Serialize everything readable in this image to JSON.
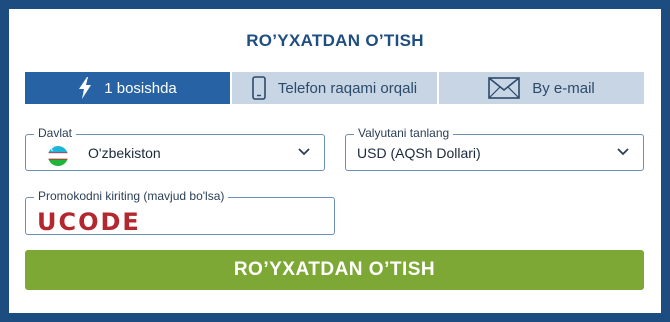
{
  "header": {
    "title": "RO’YXATDAN O’TISH"
  },
  "tabs": [
    {
      "label": "1 bosishda",
      "icon": "lightning-icon",
      "active": true
    },
    {
      "label": "Telefon raqami orqali",
      "icon": "phone-icon",
      "active": false
    },
    {
      "label": "By e-mail",
      "icon": "envelope-icon",
      "active": false
    }
  ],
  "country": {
    "label": "Davlat",
    "value": "O'zbekiston",
    "flag": "uzbekistan-flag-icon"
  },
  "currency": {
    "label": "Valyutani tanlang",
    "value": "USD (AQSh Dollari)"
  },
  "promo": {
    "label": "Promokodni kiriting (mavjud bo'lsa)",
    "value": "UCODE"
  },
  "submit": {
    "label": "RO’YXATDAN O’TISH"
  },
  "colors": {
    "frame": "#1d4d80",
    "accent": "#2763a4",
    "tab_inactive": "#c7d5e4",
    "submit": "#7ea835",
    "promo_text": "#b3272f"
  }
}
